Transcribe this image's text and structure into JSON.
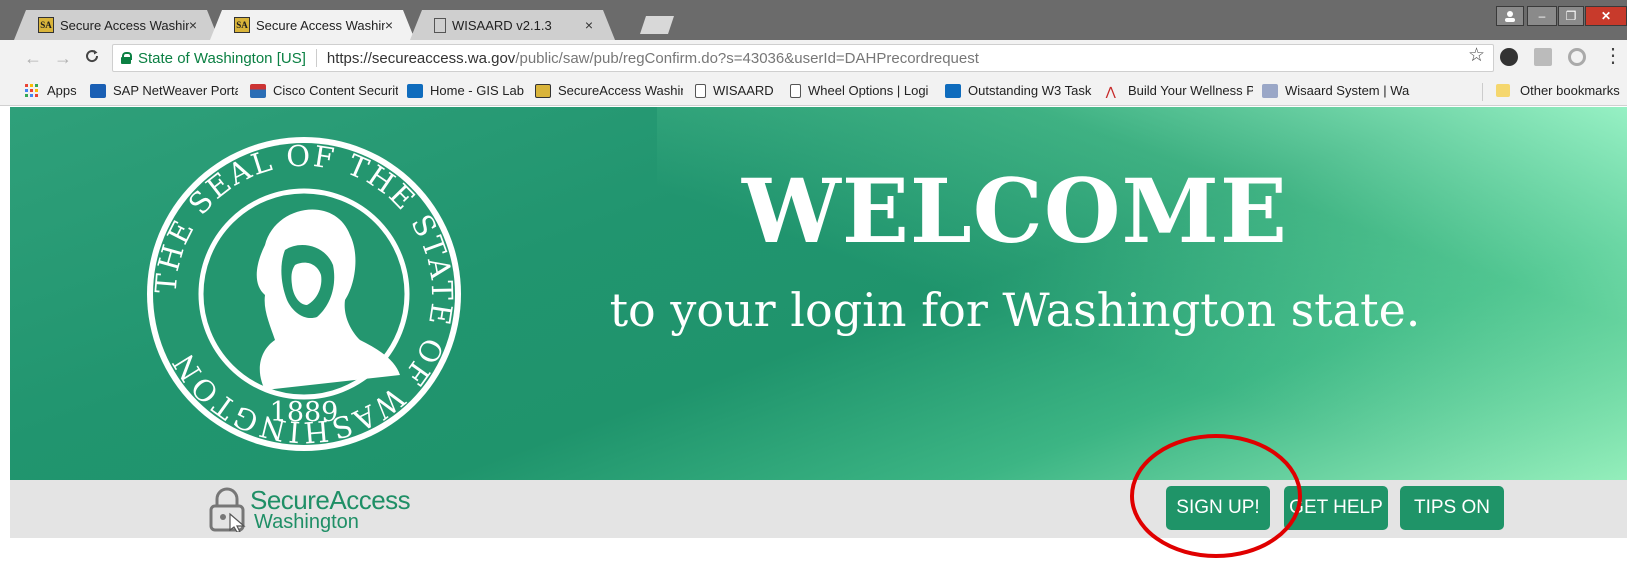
{
  "browser": {
    "tabs": [
      {
        "title": "Secure Access Washingto",
        "favicon": "SA"
      },
      {
        "title": "Secure Access Washingto",
        "favicon": "SA"
      },
      {
        "title": "WISAARD v2.1.3",
        "favicon": ""
      }
    ],
    "tab_close": "×",
    "window_controls": {
      "minimize": "–",
      "maximize": "❐",
      "close": "✕"
    },
    "nav": {
      "back": "←",
      "forward": "→",
      "reload": "C"
    },
    "address": {
      "site_name": "State of Washington [US]",
      "url_host": "https://secureaccess.wa.gov",
      "url_path": "/public/saw/pub/regConfirm.do?s=43036&userId=DAHPrecordrequest"
    },
    "star": "☆",
    "bookmarks": [
      {
        "label": "Apps",
        "icon": "apps-grid-icon"
      },
      {
        "label": "SAP NetWeaver Porta",
        "icon": "sap-icon"
      },
      {
        "label": "Cisco Content Securit",
        "icon": "cisco-icon"
      },
      {
        "label": "Home - GIS Lab",
        "icon": "sharepoint-icon"
      },
      {
        "label": "SecureAccess Washin",
        "icon": "sa-icon"
      },
      {
        "label": "WISAARD",
        "icon": "page-icon"
      },
      {
        "label": "Wheel Options | Logi",
        "icon": "page-icon"
      },
      {
        "label": "Outstanding W3 Task",
        "icon": "sharepoint-icon"
      },
      {
        "label": "Build Your Wellness P",
        "icon": "adobe-icon"
      },
      {
        "label": "Wisaard System | Wa",
        "icon": "dahp-icon"
      }
    ],
    "other_bookmarks": "Other bookmarks"
  },
  "hero": {
    "welcome": "WELCOME",
    "tagline": "to your login for Washington state.",
    "seal": {
      "top_text": "THE SEAL OF THE STATE OF WASHINGTON",
      "year": "1889"
    }
  },
  "footer": {
    "brand_title": "SecureAccess",
    "brand_sub": "Washington",
    "buttons": {
      "signup": "SIGN UP!",
      "help": "GET HELP",
      "tips": "TIPS ON"
    }
  },
  "colors": {
    "brand_green": "#1f9468",
    "annotation_red": "#e00000"
  }
}
